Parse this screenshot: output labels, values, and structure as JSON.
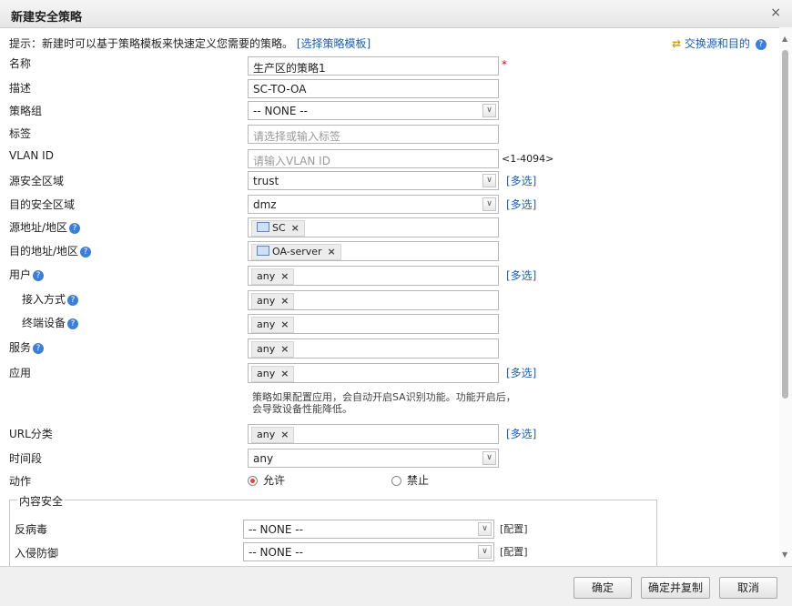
{
  "dialog": {
    "title": "新建安全策略",
    "close": "×"
  },
  "tip": {
    "text": "提示：新建时可以基于策略模板来快速定义您需要的策略。",
    "link": "[选择策略模板]"
  },
  "swap": {
    "label": "交换源和目的"
  },
  "fields": {
    "name": {
      "label": "名称",
      "value": "生产区的策略1",
      "required": "*"
    },
    "desc": {
      "label": "描述",
      "value": "SC-TO-OA"
    },
    "group": {
      "label": "策略组",
      "value": "-- NONE --"
    },
    "tag": {
      "label": "标签",
      "placeholder": "请选择或输入标签"
    },
    "vlan": {
      "label": "VLAN ID",
      "placeholder": "请输入VLAN ID",
      "hint": "<1-4094>"
    },
    "src_zone": {
      "label": "源安全区域",
      "value": "trust",
      "multi": "[多选]"
    },
    "dst_zone": {
      "label": "目的安全区域",
      "value": "dmz",
      "multi": "[多选]"
    },
    "src_addr": {
      "label": "源地址/地区",
      "tag": "SC"
    },
    "dst_addr": {
      "label": "目的地址/地区",
      "tag": "OA-server"
    },
    "user": {
      "label": "用户",
      "tag": "any",
      "multi": "[多选]"
    },
    "access": {
      "label": "接入方式",
      "tag": "any"
    },
    "terminal": {
      "label": "终端设备",
      "tag": "any"
    },
    "service": {
      "label": "服务",
      "tag": "any"
    },
    "app": {
      "label": "应用",
      "tag": "any",
      "multi": "[多选]",
      "note": "策略如果配置应用，会自动开启SA识别功能。功能开启后，会导致设备性能降低。"
    },
    "url": {
      "label": "URL分类",
      "tag": "any",
      "multi": "[多选]"
    },
    "time": {
      "label": "时间段",
      "value": "any"
    },
    "action": {
      "label": "动作",
      "allow": "允许",
      "deny": "禁止",
      "selected": "allow"
    }
  },
  "content_security": {
    "legend": "内容安全",
    "antivirus": {
      "label": "反病毒",
      "value": "-- NONE --",
      "config": "[配置]"
    },
    "ips": {
      "label": "入侵防御",
      "value": "-- NONE --",
      "config": "[配置]"
    }
  },
  "buttons": {
    "ok": "确定",
    "ok_copy": "确定并复制",
    "cancel": "取消"
  },
  "icons": {
    "help": "?",
    "tag_remove": "×",
    "select_arrow": "∨"
  }
}
